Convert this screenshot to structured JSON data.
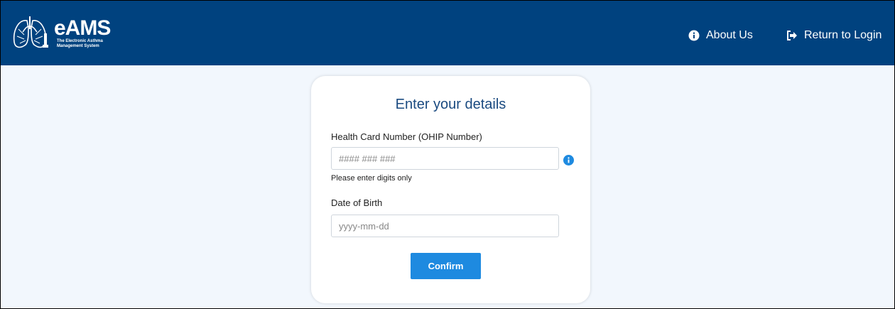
{
  "header": {
    "logo_text": "eAMS",
    "logo_subtitle": "The Electronic Asthma Management System",
    "nav": {
      "about_label": "About Us",
      "return_label": "Return to Login"
    }
  },
  "form": {
    "title": "Enter your details",
    "health_card": {
      "label": "Health Card Number (OHIP Number)",
      "placeholder": "#### ### ###",
      "value": "",
      "hint": "Please enter digits only"
    },
    "dob": {
      "label": "Date of Birth",
      "placeholder": "yyyy-mm-dd",
      "value": ""
    },
    "confirm_label": "Confirm"
  },
  "colors": {
    "navbar": "#00427f",
    "page_background": "#f2f7fd",
    "primary_button": "#1e8ae0",
    "title_text": "#1a4a80"
  },
  "icons": {
    "logo": "lungs-icon",
    "about": "info-circle-icon",
    "return": "sign-out-icon",
    "field_help": "info-circle-icon"
  }
}
